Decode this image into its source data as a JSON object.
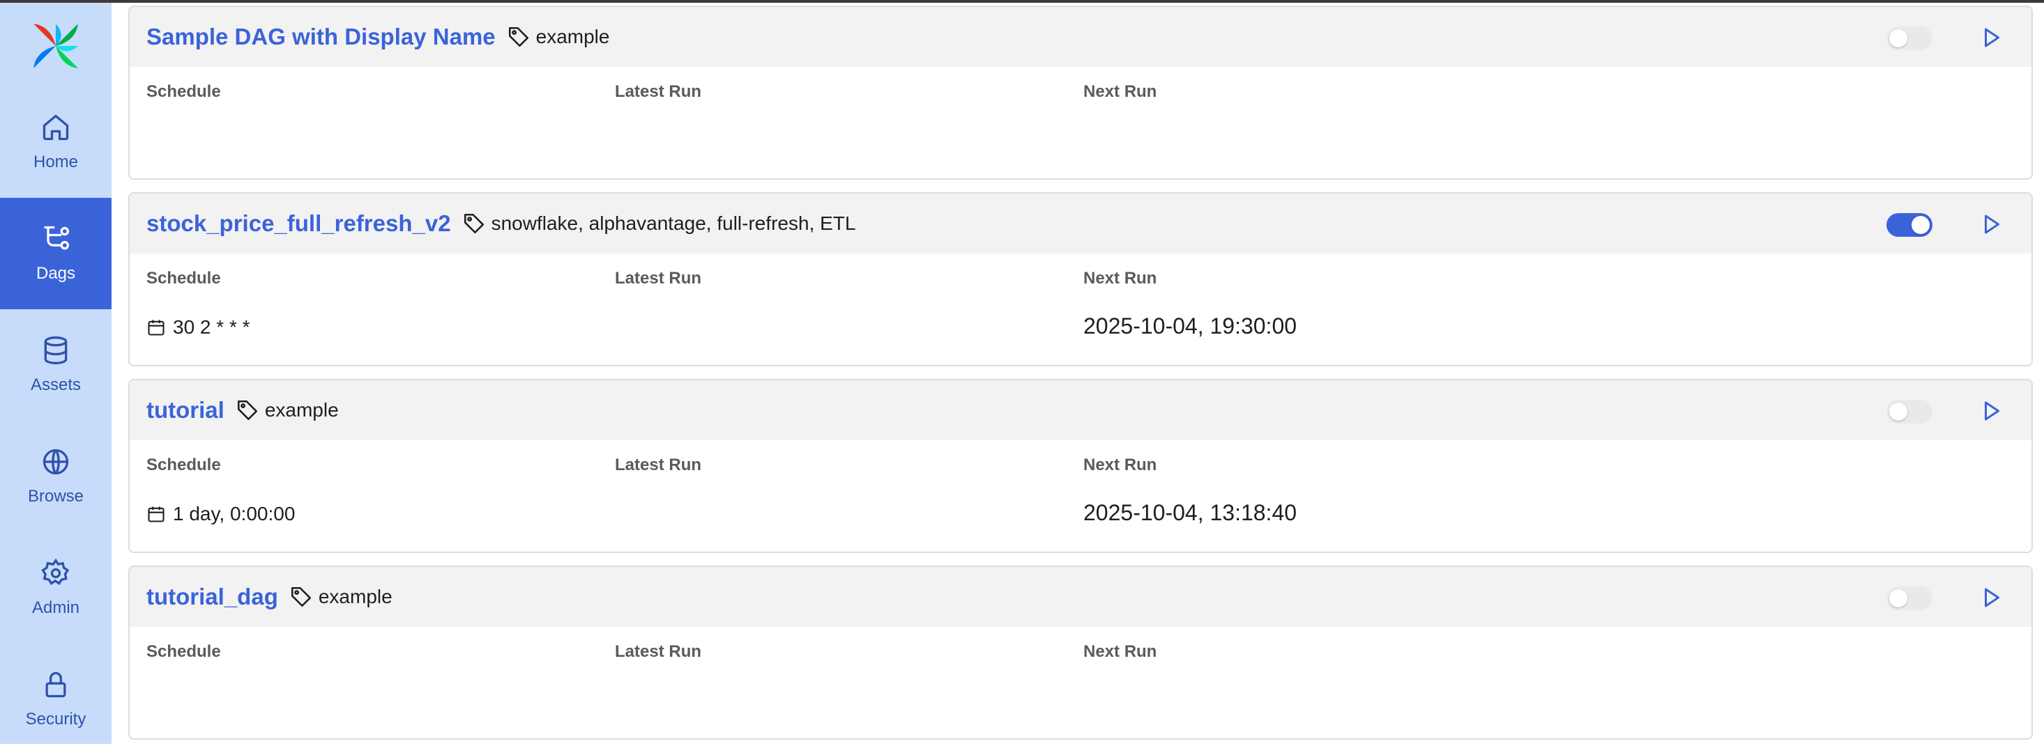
{
  "sidebar": {
    "items": [
      {
        "label": "Home",
        "icon": "home-icon"
      },
      {
        "label": "Dags",
        "icon": "dags-icon",
        "active": true
      },
      {
        "label": "Assets",
        "icon": "database-icon"
      },
      {
        "label": "Browse",
        "icon": "globe-icon"
      },
      {
        "label": "Admin",
        "icon": "gear-icon"
      },
      {
        "label": "Security",
        "icon": "lock-icon"
      }
    ]
  },
  "columns": {
    "schedule": "Schedule",
    "latest": "Latest Run",
    "next": "Next Run"
  },
  "dags": [
    {
      "title": "Sample DAG with Display Name",
      "tags": "example",
      "enabled": false,
      "schedule": "",
      "next_run": ""
    },
    {
      "title": "stock_price_full_refresh_v2",
      "tags": "snowflake, alphavantage, full-refresh, ETL",
      "enabled": true,
      "schedule": "30 2 * * *",
      "next_run": "2025-10-04, 19:30:00"
    },
    {
      "title": "tutorial",
      "tags": "example",
      "enabled": false,
      "schedule": "1 day, 0:00:00",
      "next_run": "2025-10-04, 13:18:40"
    },
    {
      "title": "tutorial_dag",
      "tags": "example",
      "enabled": false,
      "schedule": "",
      "next_run": ""
    }
  ],
  "colors": {
    "accent": "#3b63d9",
    "sidebar_bg": "#c7dcfb",
    "header_bg": "#f2f2f2"
  }
}
